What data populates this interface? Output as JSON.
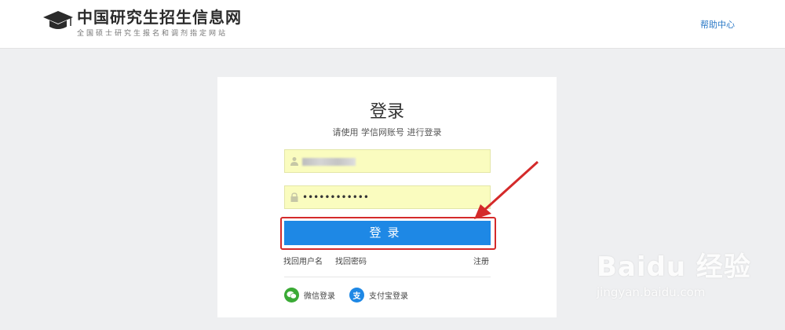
{
  "header": {
    "site_title": "中国研究生招生信息网",
    "site_subtitle": "全国硕士研究生报名和调剂指定网站",
    "help_link": "帮助中心"
  },
  "login": {
    "title": "登录",
    "hint": "请使用 学信网账号 进行登录",
    "password_masked": "••••••••••••",
    "submit_label": "登录",
    "find_username": "找回用户名",
    "find_password": "找回密码",
    "register": "注册",
    "wechat_login": "微信登录",
    "alipay_login": "支付宝登录",
    "alipay_glyph": "支"
  },
  "watermark": {
    "brand": "Baidu 经验",
    "url": "jingyan.baidu.com"
  },
  "colors": {
    "primary_button": "#1e88e5",
    "highlight_box": "#d42a2a",
    "autofill_bg": "#fafcbf",
    "link_blue": "#2a78c6",
    "wechat_green": "#3aaa35"
  },
  "icons": [
    "graduation-cap-icon",
    "user-icon",
    "lock-icon",
    "wechat-icon",
    "alipay-icon",
    "red-arrow-annotation"
  ]
}
